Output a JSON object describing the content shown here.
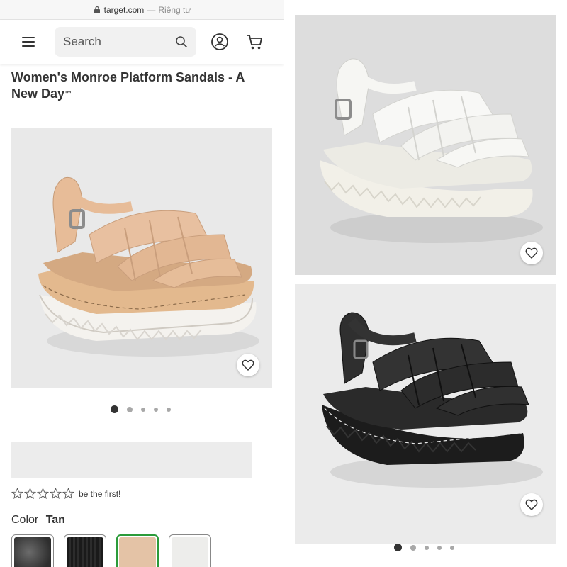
{
  "browser": {
    "domain": "target.com",
    "separator": "—",
    "private_label": "Riêng tư"
  },
  "header": {
    "menu_icon": "hamburger-menu-icon",
    "search_placeholder": "Search",
    "search_icon": "search-icon",
    "account_icon": "account-icon",
    "cart_icon": "cart-icon"
  },
  "product": {
    "title": "Women's Monroe Platform Sandals - A New Day",
    "trademark": "™",
    "main_image_color": "tan",
    "gallery_dots": 5,
    "gallery_active_index": 0,
    "rating": {
      "stars_filled": 0,
      "stars_total": 5,
      "link_text": "be the first!"
    },
    "color": {
      "label": "Color",
      "value": "Tan"
    },
    "swatches": [
      {
        "name": "gray-sparkle",
        "selected": false
      },
      {
        "name": "black",
        "selected": false
      },
      {
        "name": "tan",
        "selected": true
      },
      {
        "name": "white",
        "selected": false
      }
    ]
  },
  "right_panel": {
    "images": [
      {
        "color": "white"
      },
      {
        "color": "black",
        "gallery_dots": 5,
        "gallery_active_index": 0
      }
    ]
  },
  "colors": {
    "selected_swatch_border": "#2b9b3a",
    "text": "#333333",
    "image_background": "#e9e9e9"
  }
}
